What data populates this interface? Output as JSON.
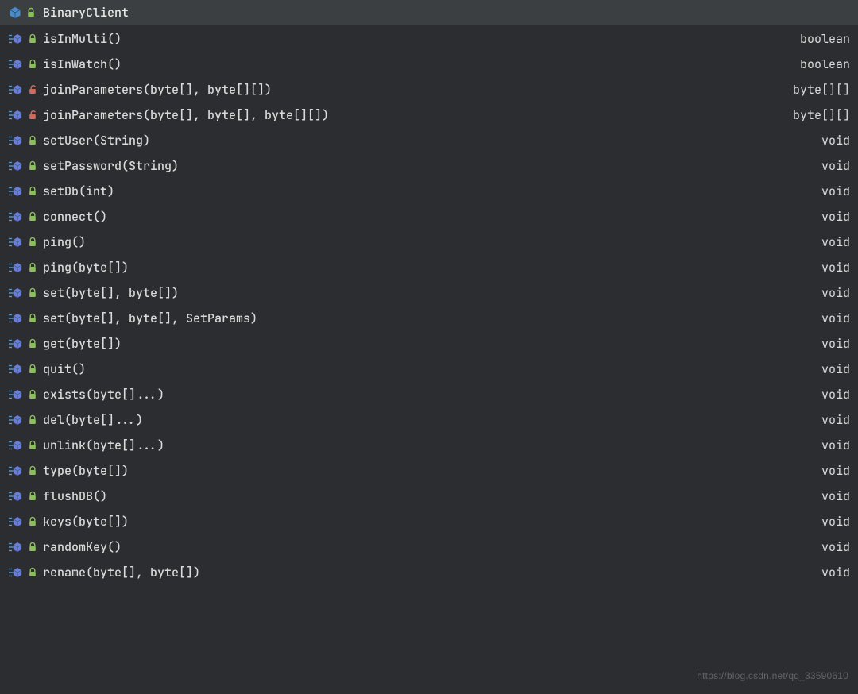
{
  "class": {
    "name": "BinaryClient",
    "access": "public"
  },
  "members": [
    {
      "signature": "isInMulti()",
      "return": "boolean",
      "access": "public"
    },
    {
      "signature": "isInWatch()",
      "return": "boolean",
      "access": "public"
    },
    {
      "signature": "joinParameters(byte[], byte[][])",
      "return": "byte[][]",
      "access": "private"
    },
    {
      "signature": "joinParameters(byte[], byte[], byte[][])",
      "return": "byte[][]",
      "access": "private"
    },
    {
      "signature": "setUser(String)",
      "return": "void",
      "access": "public"
    },
    {
      "signature": "setPassword(String)",
      "return": "void",
      "access": "public"
    },
    {
      "signature": "setDb(int)",
      "return": "void",
      "access": "public"
    },
    {
      "signature": "connect()",
      "return": "void",
      "access": "public"
    },
    {
      "signature": "ping()",
      "return": "void",
      "access": "public"
    },
    {
      "signature": "ping(byte[])",
      "return": "void",
      "access": "public"
    },
    {
      "signature": "set(byte[], byte[])",
      "return": "void",
      "access": "public"
    },
    {
      "signature": "set(byte[], byte[], SetParams)",
      "return": "void",
      "access": "public"
    },
    {
      "signature": "get(byte[])",
      "return": "void",
      "access": "public"
    },
    {
      "signature": "quit()",
      "return": "void",
      "access": "public"
    },
    {
      "signature": "exists(byte[]...)",
      "return": "void",
      "access": "public"
    },
    {
      "signature": "del(byte[]...)",
      "return": "void",
      "access": "public"
    },
    {
      "signature": "unlink(byte[]...)",
      "return": "void",
      "access": "public"
    },
    {
      "signature": "type(byte[])",
      "return": "void",
      "access": "public"
    },
    {
      "signature": "flushDB()",
      "return": "void",
      "access": "public"
    },
    {
      "signature": "keys(byte[])",
      "return": "void",
      "access": "public"
    },
    {
      "signature": "randomKey()",
      "return": "void",
      "access": "public"
    },
    {
      "signature": "rename(byte[], byte[])",
      "return": "void",
      "access": "public"
    }
  ],
  "watermark": "https://blog.csdn.net/qq_33590610"
}
